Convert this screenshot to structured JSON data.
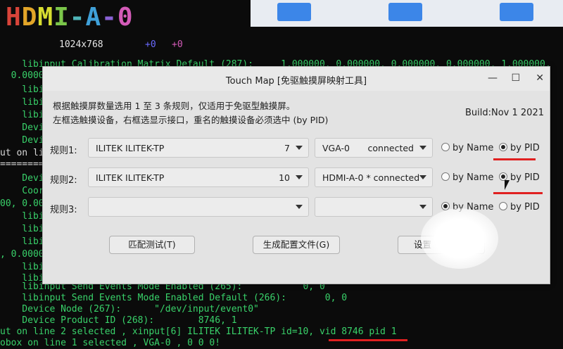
{
  "hdmi_header": {
    "chars": [
      "H",
      "D",
      "M",
      "I",
      "-",
      "A",
      "-",
      "0"
    ],
    "colors": [
      "#d8443a",
      "#e2a528",
      "#d7dd30",
      "#7bc64a",
      "#4fb5b8",
      "#3fa0d8",
      "#8a62d6",
      "#d45bb8"
    ],
    "resolution": "1024x768",
    "offset_x": "+0",
    "offset_y": "+0"
  },
  "terminal": {
    "lines_top": [
      "    libinput Calibration Matrix Default (287):     1.000000, 0.000000, 0.000000, 0.000000, 1.000000,",
      "  0.000000"
    ],
    "lines_side": [
      "    libi",
      "    libi",
      "    libi",
      "    Devi",
      "    Devi",
      "ut on li",
      "=========",
      "    Devi",
      "    Coor",
      "00, 0.00",
      "    libi",
      "    libi",
      "    libi",
      ", 0.0000",
      "    libi",
      "    libi"
    ],
    "lines_bottom": [
      "    libinput Send Events Mode Enabled (265):           0, 0",
      "    libinput Send Events Mode Enabled Default (266):       0, 0",
      "    Device Node (267):      \"/dev/input/event0\"",
      "    Device Product ID (268):        8746, 1",
      "ut on line 2 selected , xinput[6] ILITEK ILITEK-TP id=10, vid 8746 pid 1",
      "obox on line 1 selected , VGA-0 , 0 0 0!"
    ]
  },
  "dialog": {
    "title": "Touch Map [免驱触摸屏映射工具]",
    "window_buttons": {
      "minimize": "—",
      "maximize": "☐",
      "close": "✕"
    },
    "description": [
      "根据触摸屏数量选用 1 至 3 条规则，仅适用于免驱型触摸屏。",
      "左框选触摸设备，右框选显示接口，重名的触摸设备必须选中 (by PID)"
    ],
    "build": "Build:Nov  1 2021",
    "rules": [
      {
        "label": "规则1:",
        "device": "ILITEK ILITEK-TP",
        "device_num": "7",
        "output": "VGA-0",
        "status": "connected",
        "by_name": "by Name",
        "by_pid": "by PID",
        "selected": "pid"
      },
      {
        "label": "规则2:",
        "device": "ILITEK ILITEK-TP",
        "device_num": "10",
        "output": "HDMI-A-0 * connected",
        "status": "",
        "by_name": "by Name",
        "by_pid": "by PID",
        "selected": "pid"
      },
      {
        "label": "规则3:",
        "device": "",
        "device_num": "",
        "output": "",
        "status": "",
        "by_name": "by Name",
        "by_pid": "by PID",
        "selected": "name"
      }
    ],
    "buttons": {
      "match_test": "匹配测试(T)",
      "generate_config": "生成配置文件(G)",
      "settings": "设置"
    }
  },
  "colors": {
    "annotation_red": "#e02020",
    "terminal_green": "#39d26a"
  }
}
